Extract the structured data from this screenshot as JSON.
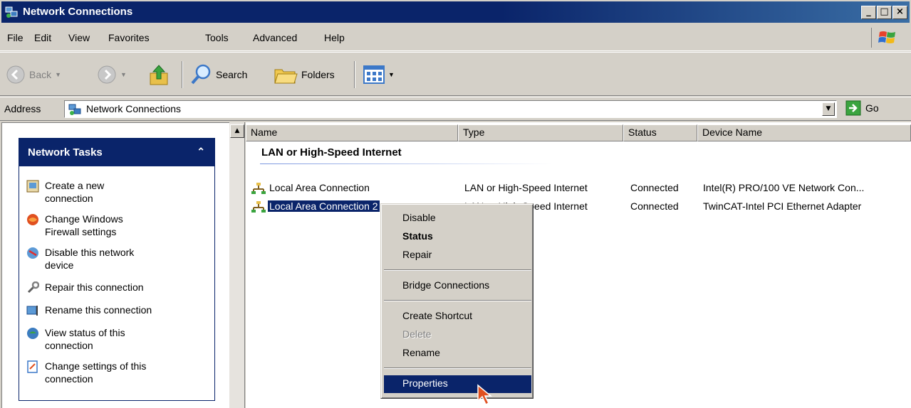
{
  "window": {
    "title": "Network Connections",
    "buttons": [
      "_",
      "□",
      "×"
    ]
  },
  "menu": [
    "File",
    "Edit",
    "View",
    "Favorites",
    "Tools",
    "Advanced",
    "Help"
  ],
  "toolbar": {
    "back": "Back",
    "search": "Search",
    "folders": "Folders"
  },
  "address": {
    "label": "Address",
    "value": "Network Connections",
    "go": "Go"
  },
  "tasks": {
    "title": "Network Tasks",
    "items": [
      {
        "label": "Create a new connection",
        "icon": "new-connection-icon"
      },
      {
        "label": "Change Windows Firewall settings",
        "icon": "firewall-icon"
      },
      {
        "label": "Disable this network device",
        "icon": "disable-device-icon"
      },
      {
        "label": "Repair this connection",
        "icon": "repair-icon"
      },
      {
        "label": "Rename this connection",
        "icon": "rename-icon"
      },
      {
        "label": "View status of this connection",
        "icon": "view-status-icon"
      },
      {
        "label": "Change settings of this connection",
        "icon": "change-settings-icon"
      }
    ]
  },
  "columns": [
    "Name",
    "Type",
    "Status",
    "Device Name"
  ],
  "group": "LAN or High-Speed Internet",
  "rows": [
    {
      "name": "Local Area Connection",
      "type": "LAN or High-Speed Internet",
      "status": "Connected",
      "device": "Intel(R) PRO/100 VE Network Con..."
    },
    {
      "name": "Local Area Connection 2",
      "type": "LAN or High-Speed Internet",
      "status": "Connected",
      "device": "TwinCAT-Intel PCI Ethernet Adapter"
    }
  ],
  "context_menu": {
    "disable": "Disable",
    "status": "Status",
    "repair": "Repair",
    "bridge": "Bridge Connections",
    "shortcut": "Create Shortcut",
    "delete": "Delete",
    "rename": "Rename",
    "properties": "Properties"
  },
  "colors": {
    "title_blue": "#0a246a",
    "face": "#d4d0c8",
    "selection": "#0a246a"
  }
}
